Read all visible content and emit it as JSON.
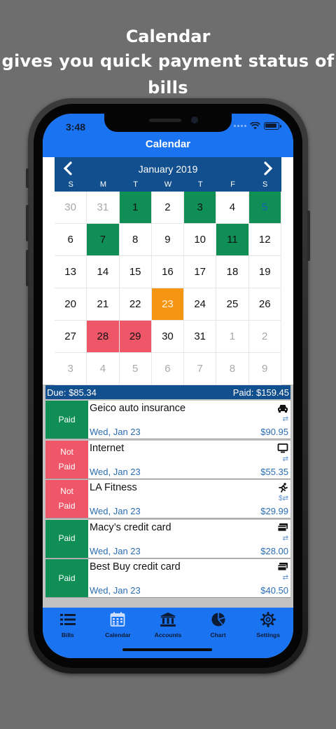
{
  "promo": {
    "line1": "Calendar",
    "line2": "gives you quick payment status of bills"
  },
  "status_bar": {
    "time": "3:48"
  },
  "header": {
    "title": "Calendar"
  },
  "calendar": {
    "month_title": "January 2019",
    "weekdays": [
      "S",
      "M",
      "T",
      "W",
      "T",
      "F",
      "S"
    ],
    "weeks": [
      [
        {
          "d": "30",
          "s": "out"
        },
        {
          "d": "31",
          "s": "out"
        },
        {
          "d": "1",
          "s": "paid"
        },
        {
          "d": "2",
          "s": ""
        },
        {
          "d": "3",
          "s": "paid"
        },
        {
          "d": "4",
          "s": ""
        },
        {
          "d": "5",
          "s": "paid blue"
        }
      ],
      [
        {
          "d": "6",
          "s": ""
        },
        {
          "d": "7",
          "s": "paid"
        },
        {
          "d": "8",
          "s": ""
        },
        {
          "d": "9",
          "s": ""
        },
        {
          "d": "10",
          "s": ""
        },
        {
          "d": "11",
          "s": "paid"
        },
        {
          "d": "12",
          "s": ""
        }
      ],
      [
        {
          "d": "13",
          "s": ""
        },
        {
          "d": "14",
          "s": ""
        },
        {
          "d": "15",
          "s": ""
        },
        {
          "d": "16",
          "s": ""
        },
        {
          "d": "17",
          "s": ""
        },
        {
          "d": "18",
          "s": ""
        },
        {
          "d": "19",
          "s": ""
        }
      ],
      [
        {
          "d": "20",
          "s": ""
        },
        {
          "d": "21",
          "s": ""
        },
        {
          "d": "22",
          "s": ""
        },
        {
          "d": "23",
          "s": "today"
        },
        {
          "d": "24",
          "s": ""
        },
        {
          "d": "25",
          "s": ""
        },
        {
          "d": "26",
          "s": ""
        }
      ],
      [
        {
          "d": "27",
          "s": ""
        },
        {
          "d": "28",
          "s": "due"
        },
        {
          "d": "29",
          "s": "due"
        },
        {
          "d": "30",
          "s": ""
        },
        {
          "d": "31",
          "s": ""
        },
        {
          "d": "1",
          "s": "out"
        },
        {
          "d": "2",
          "s": "out"
        }
      ],
      [
        {
          "d": "3",
          "s": "out"
        },
        {
          "d": "4",
          "s": "out"
        },
        {
          "d": "5",
          "s": "out"
        },
        {
          "d": "6",
          "s": "out"
        },
        {
          "d": "7",
          "s": "out"
        },
        {
          "d": "8",
          "s": "out"
        },
        {
          "d": "9",
          "s": "out"
        }
      ]
    ]
  },
  "summary": {
    "due": "Due: $85.34",
    "paid": "Paid: $159.45"
  },
  "bills": [
    {
      "status": "Paid",
      "status_type": "paid",
      "name": "Geico auto insurance",
      "date": "Wed, Jan 23",
      "amount": "$90.95",
      "icon": "car-icon"
    },
    {
      "status": "Not\nPaid",
      "status_type": "notpaid",
      "name": "Internet",
      "date": "Wed, Jan 23",
      "amount": "$55.35",
      "icon": "monitor-icon"
    },
    {
      "status": "Not\nPaid",
      "status_type": "notpaid",
      "name": "LA Fitness",
      "date": "Wed, Jan 23",
      "amount": "$29.99",
      "icon": "runner-icon"
    },
    {
      "status": "Paid",
      "status_type": "paid",
      "name": "Macy’s credit card",
      "date": "Wed, Jan 23",
      "amount": "$28.00",
      "icon": "credit-card-icon"
    },
    {
      "status": "Paid",
      "status_type": "paid",
      "name": "Best Buy credit card",
      "date": "Wed, Jan 23",
      "amount": "$40.50",
      "icon": "credit-card-icon"
    }
  ],
  "tabs": [
    {
      "label": "Bills",
      "icon": "list-icon"
    },
    {
      "label": "Calendar",
      "icon": "calendar-icon"
    },
    {
      "label": "Accounts",
      "icon": "bank-icon"
    },
    {
      "label": "Chart",
      "icon": "pie-chart-icon"
    },
    {
      "label": "Settings",
      "icon": "gear-icon"
    }
  ],
  "colors": {
    "primary": "#1a74f2",
    "navy": "#124f8e",
    "paid": "#0f8f55",
    "not_paid": "#ef5769",
    "today": "#f59511"
  }
}
